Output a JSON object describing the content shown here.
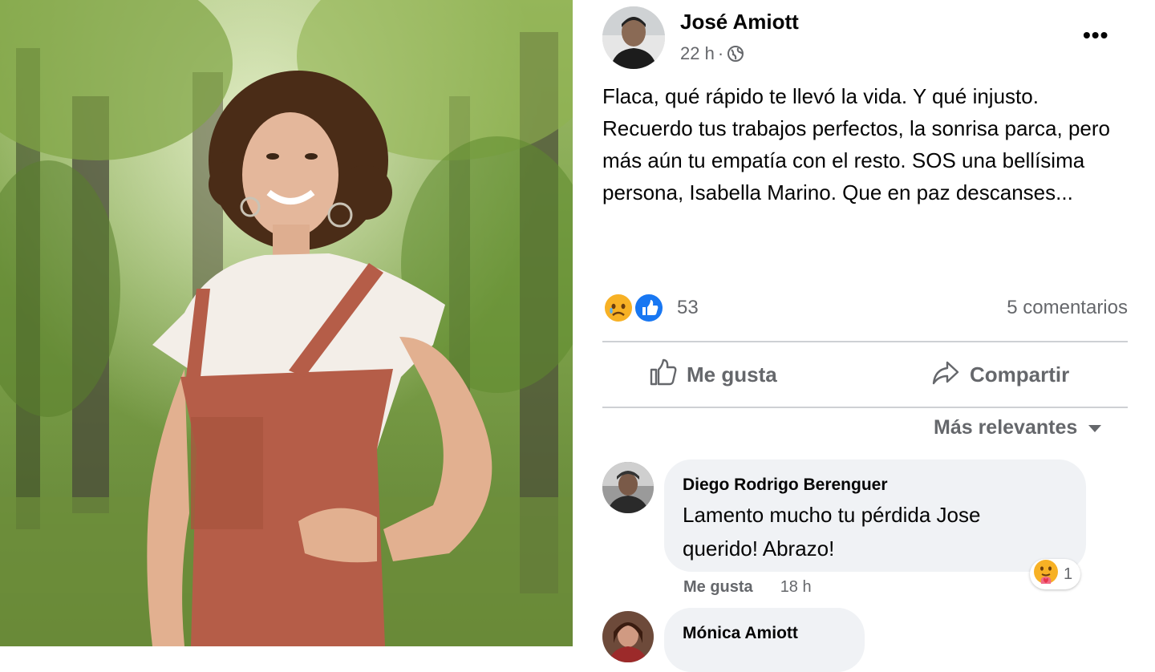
{
  "post": {
    "author": "José Amiott",
    "time": "22 h",
    "separator": "·",
    "audience_icon": "globe-icon",
    "more_label": "•••",
    "body": "Flaca, qué rápido te llevó la vida. Y qué injusto. Recuerdo tus trabajos perfectos, la sonrisa parca, pero más aún tu empatía con el resto. SOS una bellísima persona, Isabella Marino. Que en paz descanses...",
    "reaction_icons": [
      "sad-reaction-icon",
      "like-reaction-icon"
    ],
    "reaction_count": "53",
    "comments_count": "5 comentarios"
  },
  "actions": {
    "like_label": "Me gusta",
    "share_label": "Compartir"
  },
  "sort": {
    "label": "Más relevantes"
  },
  "comments": [
    {
      "author": "Diego Rodrigo Berenguer",
      "text": "Lamento mucho tu pérdida Jose querido! Abrazo!",
      "like_label": "Me gusta",
      "time": "18 h",
      "reaction_icon": "care-reaction-icon",
      "reaction_count": "1"
    },
    {
      "author": "Mónica Amiott"
    }
  ],
  "colors": {
    "text_primary": "#050505",
    "text_secondary": "#65676b",
    "bubble_bg": "#f0f2f5",
    "like_blue": "#1877f2",
    "divider": "#ced0d4"
  }
}
